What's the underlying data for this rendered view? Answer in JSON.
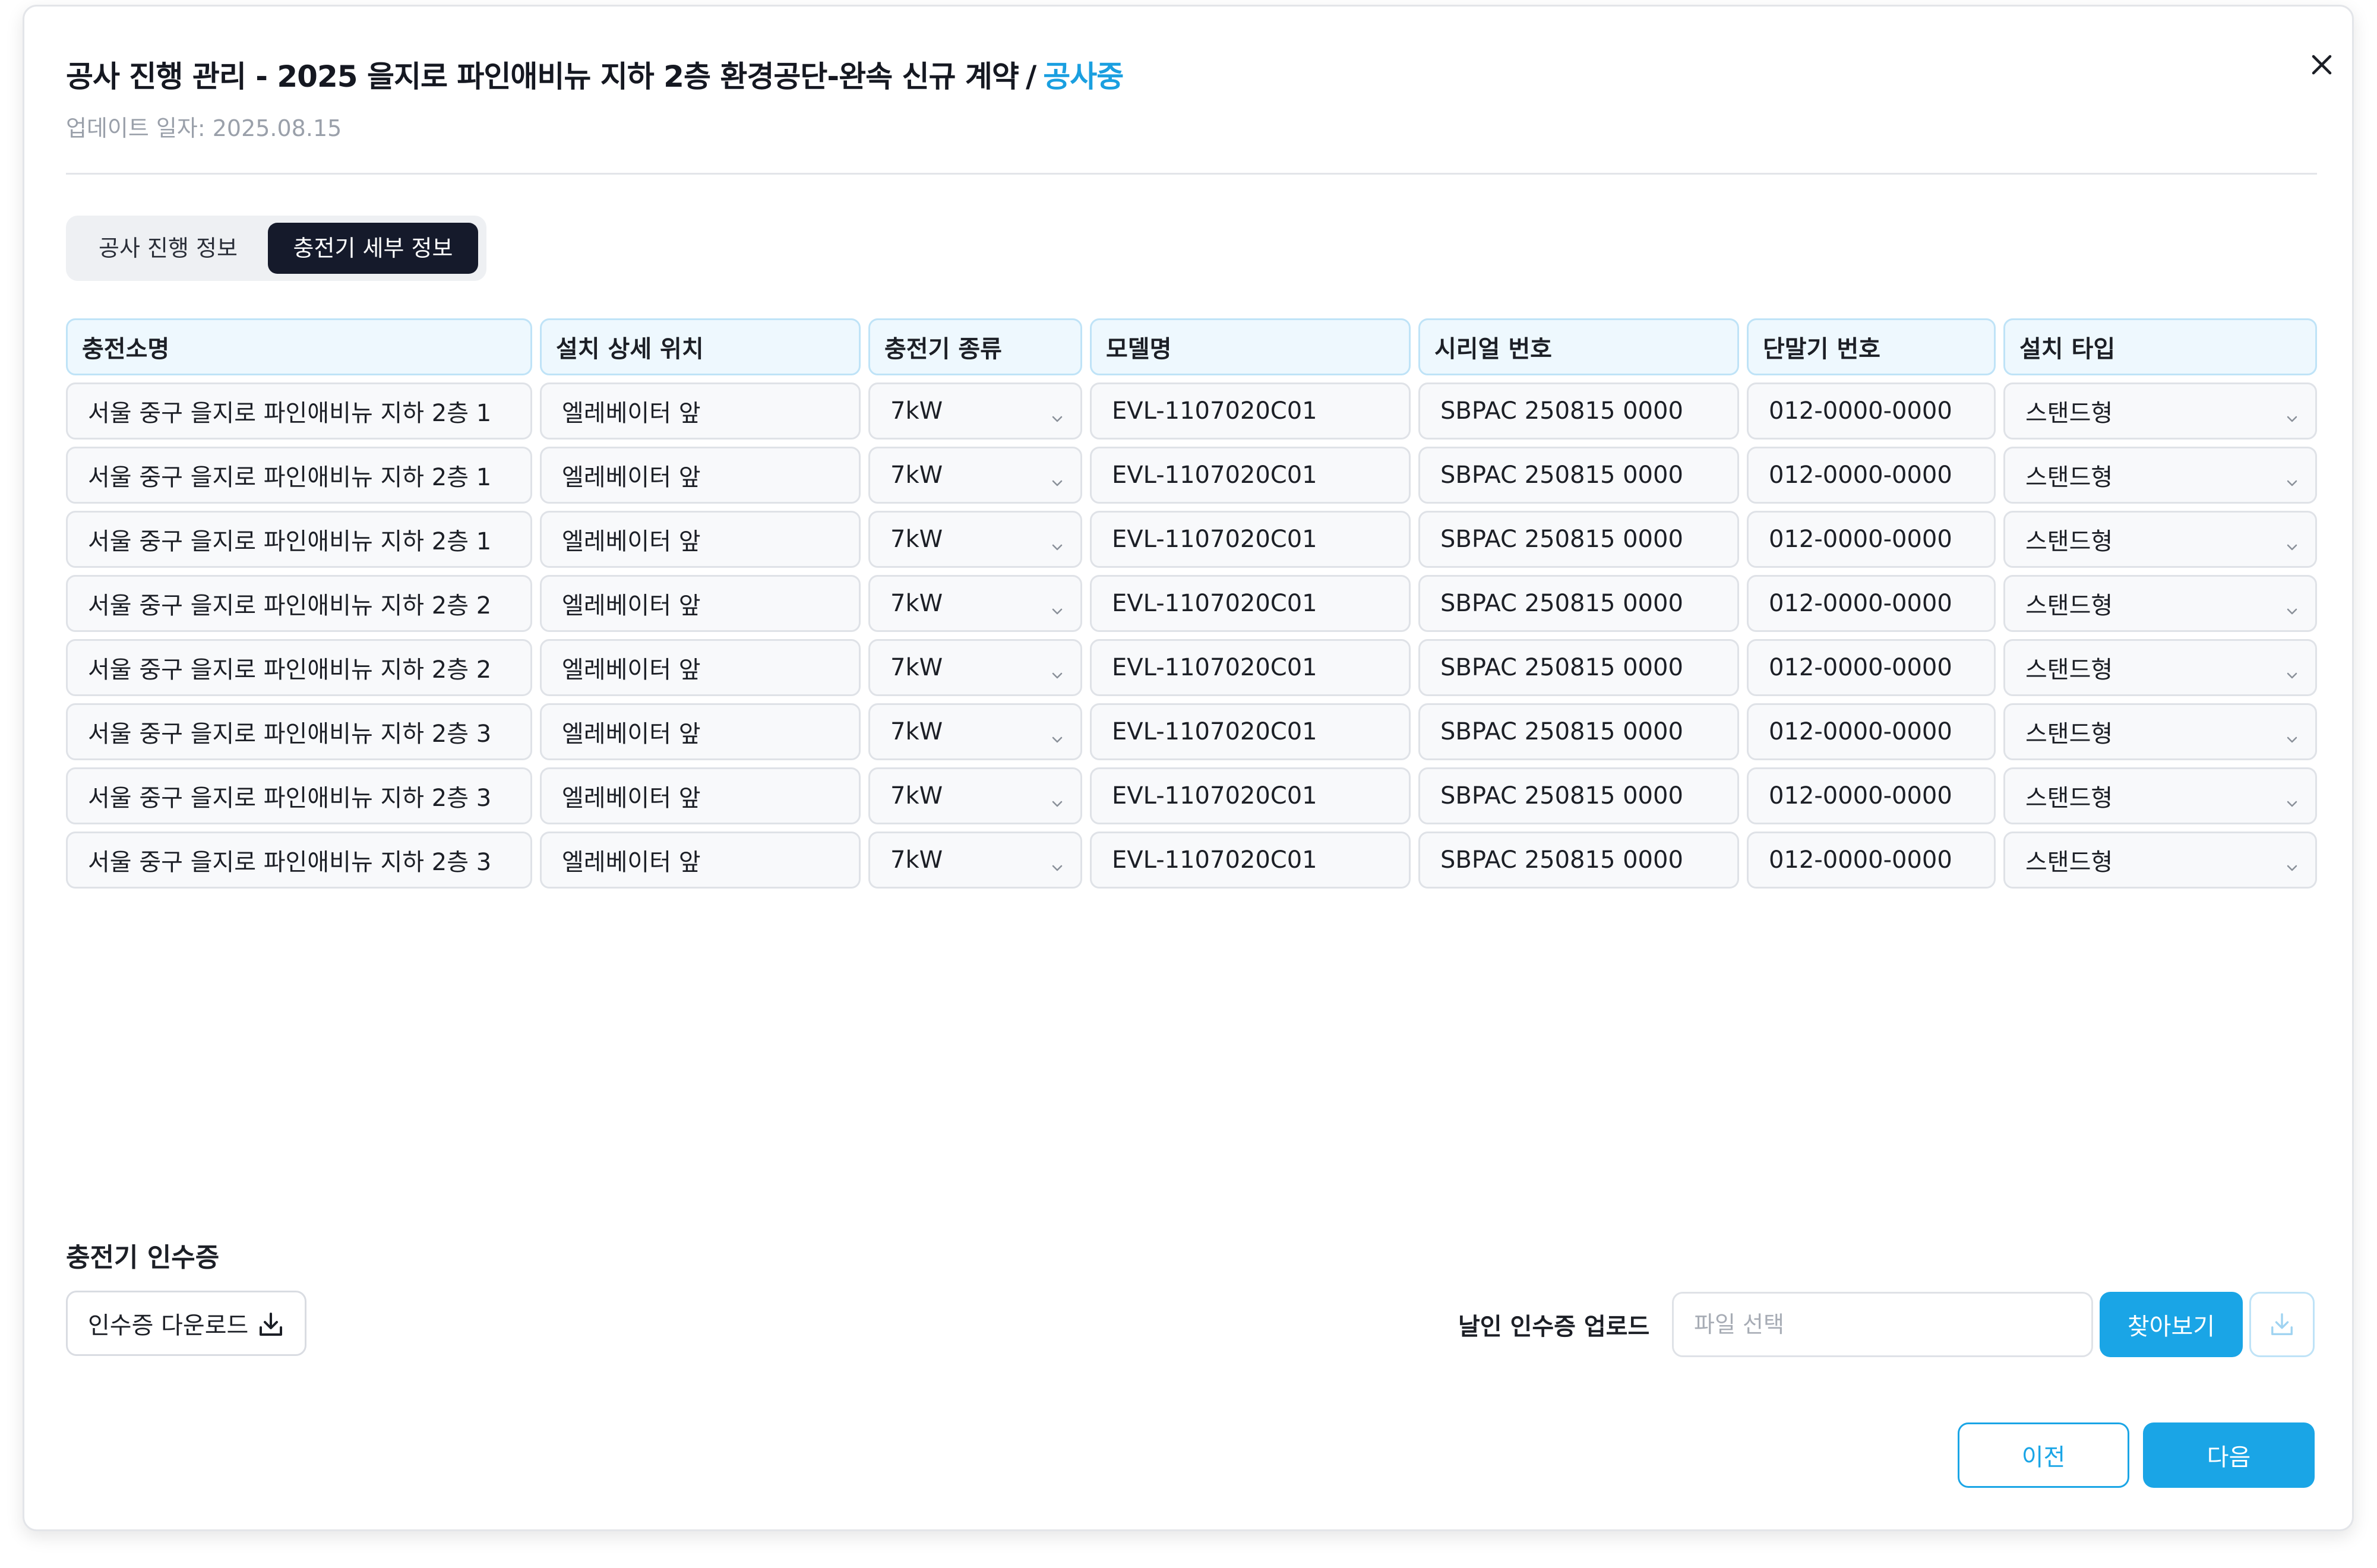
{
  "modal": {
    "title": "공사 진행 관리 - 2025 을지로 파인애비뉴 지하 2층 환경공단-완속 신규 계약",
    "separator": "/",
    "status": "공사중",
    "updated": "업데이트 일자: 2025.08.15"
  },
  "tabs": [
    {
      "label": "공사 진행 정보",
      "active": false
    },
    {
      "label": "충전기 세부 정보",
      "active": true
    }
  ],
  "table": {
    "headers": [
      "충전소명",
      "설치 상세 위치",
      "충전기 종류",
      "모델명",
      "시리얼 번호",
      "단말기 번호",
      "설치 타입"
    ],
    "rows": [
      [
        "서울 중구 을지로 파인애비뉴 지하 2층 1",
        "엘레베이터 앞",
        "7kW",
        "EVL-1107020C01",
        "SBPAC 250815 0000",
        "012-0000-0000",
        "스탠드형"
      ],
      [
        "서울 중구 을지로 파인애비뉴 지하 2층 1",
        "엘레베이터 앞",
        "7kW",
        "EVL-1107020C01",
        "SBPAC 250815 0000",
        "012-0000-0000",
        "스탠드형"
      ],
      [
        "서울 중구 을지로 파인애비뉴 지하 2층 1",
        "엘레베이터 앞",
        "7kW",
        "EVL-1107020C01",
        "SBPAC 250815 0000",
        "012-0000-0000",
        "스탠드형"
      ],
      [
        "서울 중구 을지로 파인애비뉴 지하 2층 2",
        "엘레베이터 앞",
        "7kW",
        "EVL-1107020C01",
        "SBPAC 250815 0000",
        "012-0000-0000",
        "스탠드형"
      ],
      [
        "서울 중구 을지로 파인애비뉴 지하 2층 2",
        "엘레베이터 앞",
        "7kW",
        "EVL-1107020C01",
        "SBPAC 250815 0000",
        "012-0000-0000",
        "스탠드형"
      ],
      [
        "서울 중구 을지로 파인애비뉴 지하 2층 3",
        "엘레베이터 앞",
        "7kW",
        "EVL-1107020C01",
        "SBPAC 250815 0000",
        "012-0000-0000",
        "스탠드형"
      ],
      [
        "서울 중구 을지로 파인애비뉴 지하 2층 3",
        "엘레베이터 앞",
        "7kW",
        "EVL-1107020C01",
        "SBPAC 250815 0000",
        "012-0000-0000",
        "스탠드형"
      ],
      [
        "서울 중구 을지로 파인애비뉴 지하 2층 3",
        "엘레베이터 앞",
        "7kW",
        "EVL-1107020C01",
        "SBPAC 250815 0000",
        "012-0000-0000",
        "스탠드형"
      ]
    ]
  },
  "certificate": {
    "section_title": "충전기 인수증",
    "download_label": "인수증 다운로드",
    "upload_label": "날인 인수증 업로드",
    "file_placeholder": "파일 선택",
    "browse_label": "찾아보기"
  },
  "footer": {
    "prev_label": "이전",
    "next_label": "다음"
  },
  "colors": {
    "accent": "#1aa5e6",
    "active_tab": "#151a2b",
    "header_bg": "#eef8fe"
  },
  "icons": [
    "close-icon",
    "chevron-down-icon",
    "download-icon"
  ]
}
